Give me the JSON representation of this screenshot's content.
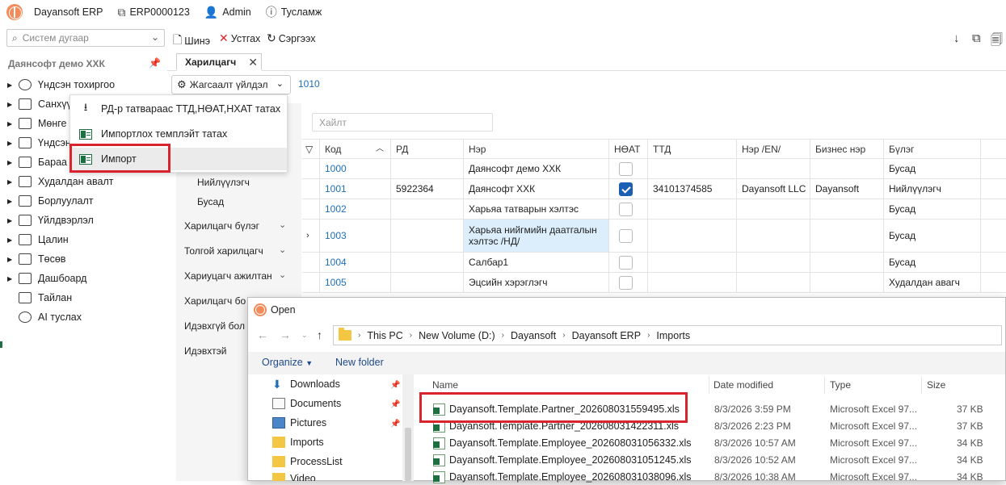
{
  "topbar": {
    "app_name": "Dayansoft ERP",
    "doc_code": "ERP0000123",
    "user": "Admin",
    "help": "Тусламж"
  },
  "toolbar": {
    "search_placeholder": "Систем дугаар",
    "new_label": "Шинэ",
    "delete_label": "Устгах",
    "refresh_label": "Сэргээх"
  },
  "sidebar": {
    "company": "Даянсофт демо ХХК",
    "items": [
      {
        "label": "Үндсэн тохиргоо",
        "icon": "gear-icon"
      },
      {
        "label": "Санхүү",
        "icon": "finance-icon"
      },
      {
        "label": "Мөнге",
        "icon": "money-icon"
      },
      {
        "label": "Үндсэн",
        "icon": "building-icon"
      },
      {
        "label": "Бараа",
        "icon": "goods-icon"
      },
      {
        "label": "Худалдан авалт",
        "icon": "purchase-icon"
      },
      {
        "label": "Борлуулалт",
        "icon": "sales-icon"
      },
      {
        "label": "Үйлдвэрлэл",
        "icon": "production-icon"
      },
      {
        "label": "Цалин",
        "icon": "salary-icon"
      },
      {
        "label": "Төсөв",
        "icon": "budget-icon"
      },
      {
        "label": "Дашбоард",
        "icon": "dashboard-icon"
      },
      {
        "label": "Тайлан",
        "icon": "report-icon"
      },
      {
        "label": "AI туслах",
        "icon": "ai-icon"
      }
    ]
  },
  "tab": {
    "label": "Харилцагч"
  },
  "actions": {
    "label": "Жагсаалт үйлдэл",
    "count": "1010"
  },
  "menu": {
    "items": [
      {
        "label": "РД-р татвараас ТТД,НӨАТ,НХАТ татах"
      },
      {
        "label": "Импортлох темплэйт татах"
      },
      {
        "label": "Импорт"
      }
    ]
  },
  "filters": {
    "sub_items": [
      "Нийлүүлэгч",
      "Бусад"
    ],
    "groups": [
      "Харилцагч бүлэг",
      "Толгой харилцагч",
      "Хариуцагч ажилтан",
      "Харилцагч бо",
      "Идэвхгүй бол",
      "Идэвхтэй"
    ]
  },
  "grid": {
    "search_placeholder": "Хайлт",
    "columns": [
      "Код",
      "РД",
      "Нэр",
      "НӨАТ",
      "ТТД",
      "Нэр /EN/",
      "Бизнес нэр",
      "Бүлэг"
    ],
    "rows": [
      {
        "code": "1000",
        "rd": "",
        "name": "Даянсофт демо ХХК",
        "vat": false,
        "ttd": "",
        "name_en": "",
        "biz": "",
        "group": "Бусад"
      },
      {
        "code": "1001",
        "rd": "5922364",
        "name": "Даянсофт ХХК",
        "vat": true,
        "ttd": "34101374585",
        "name_en": "Dayansoft LLC",
        "biz": "Dayansoft",
        "group": "Нийлүүлэгч"
      },
      {
        "code": "1002",
        "rd": "",
        "name": "Харьяа татварын хэлтэс",
        "vat": false,
        "ttd": "",
        "name_en": "",
        "biz": "",
        "group": "Бусад"
      },
      {
        "code": "1003",
        "rd": "",
        "name": "Харьяа нийгмийн даатгалын хэлтэс /НД/",
        "vat": false,
        "ttd": "",
        "name_en": "",
        "biz": "",
        "group": "Бусад"
      },
      {
        "code": "1004",
        "rd": "",
        "name": "Салбар1",
        "vat": false,
        "ttd": "",
        "name_en": "",
        "biz": "",
        "group": "Бусад"
      },
      {
        "code": "1005",
        "rd": "",
        "name": "Эцсийн хэрэглэгч",
        "vat": false,
        "ttd": "",
        "name_en": "",
        "biz": "",
        "group": "Худалдан авагч"
      }
    ]
  },
  "dialog": {
    "title": "Open",
    "path": [
      "This PC",
      "New Volume (D:)",
      "Dayansoft",
      "Dayansoft ERP",
      "Imports"
    ],
    "organize": "Organize",
    "new_folder": "New folder",
    "nav_items": [
      "Downloads",
      "Documents",
      "Pictures",
      "Imports",
      "ProcessList",
      "Video"
    ],
    "columns": [
      "Name",
      "Date modified",
      "Type",
      "Size"
    ],
    "files": [
      {
        "name": "Dayansoft.Template.Partner_202608031559495.xls",
        "date": "8/3/2026 3:59 PM",
        "type": "Microsoft Excel 97...",
        "size": "37 KB"
      },
      {
        "name": "Dayansoft.Template.Partner_202608031422311.xls",
        "date": "8/3/2026 2:23 PM",
        "type": "Microsoft Excel 97...",
        "size": "37 KB"
      },
      {
        "name": "Dayansoft.Template.Employee_202608031056332.xls",
        "date": "8/3/2026 10:57 AM",
        "type": "Microsoft Excel 97...",
        "size": "34 KB"
      },
      {
        "name": "Dayansoft.Template.Employee_202608031051245.xls",
        "date": "8/3/2026 10:52 AM",
        "type": "Microsoft Excel 97...",
        "size": "34 KB"
      },
      {
        "name": "Dayansoft.Template.Employee_202608031038096.xls",
        "date": "8/3/2026 10:38 AM",
        "type": "Microsoft Excel 97...",
        "size": "34 KB"
      }
    ]
  },
  "colors": {
    "accent": "#1e6fb8",
    "highlight": "#d9232d",
    "logo": "#f58a5a"
  }
}
